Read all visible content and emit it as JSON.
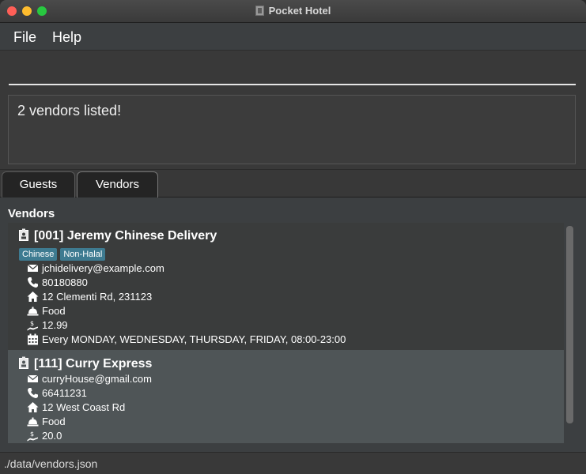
{
  "window": {
    "title": "Pocket Hotel"
  },
  "menu": {
    "file": "File",
    "help": "Help"
  },
  "command": {
    "value": "",
    "placeholder": ""
  },
  "result": {
    "message": "2 vendors listed!"
  },
  "tabs": [
    {
      "label": "Guests"
    },
    {
      "label": "Vendors",
      "selected": true
    }
  ],
  "panel": {
    "title": "Vendors"
  },
  "vendors": [
    {
      "id": "[001]",
      "name": "Jeremy Chinese Delivery",
      "tags": [
        "Chinese",
        "Non-Halal"
      ],
      "email": "jchidelivery@example.com",
      "phone": "80180880",
      "address": "12 Clementi Rd, 231123",
      "service": "Food",
      "cost": "12.99",
      "operating": "Every MONDAY, WEDNESDAY, THURSDAY, FRIDAY,  08:00-23:00"
    },
    {
      "id": "[111]",
      "name": "Curry Express",
      "tags": [],
      "email": "curryHouse@gmail.com",
      "phone": "66411231",
      "address": "12 West Coast Rd",
      "service": "Food",
      "cost": "20.0"
    }
  ],
  "status": {
    "path": "./data/vendors.json"
  },
  "colors": {
    "tag": "#3e7b91",
    "selected_card": "#4f5557",
    "card": "#3a3c3c"
  }
}
